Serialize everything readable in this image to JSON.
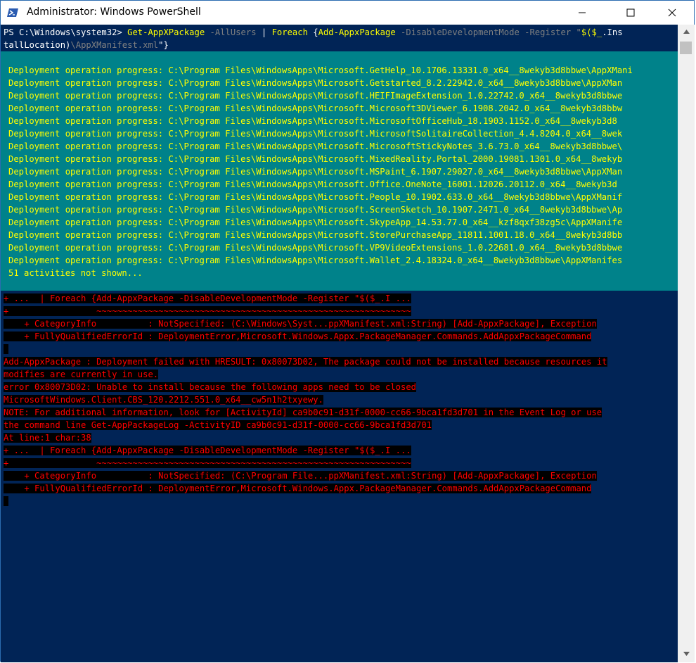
{
  "window": {
    "title": "Administrator: Windows PowerShell",
    "icon": "powershell-icon",
    "controls": [
      "minimize-icon",
      "maximize-icon",
      "close-icon"
    ]
  },
  "command": {
    "prompt": "PS C:\\Windows\\system32> ",
    "cmdlet": "Get-AppXPackage",
    "param1": " -AllUsers",
    "pipe": " | ",
    "foreach": "Foreach",
    "brace_open": " {",
    "inner_cmdlet": "Add-AppxPackage",
    "param2": " -DisableDevelopmentMode",
    "param3": " -Register",
    "str_start": " \"",
    "var_expr": "$($_",
    "prop_start": ".Ins",
    "line2_a": "tallLocation)",
    "line2_b": "\\AppXManifest.xml",
    "line2_c": "\"}"
  },
  "progress": {
    "lines": [
      "Deployment operation progress: C:\\Program Files\\WindowsApps\\Microsoft.GetHelp_10.1706.13331.0_x64__8wekyb3d8bbwe\\AppXMani",
      "Deployment operation progress: C:\\Program Files\\WindowsApps\\Microsoft.Getstarted_8.2.22942.0_x64__8wekyb3d8bbwe\\AppXMan",
      "Deployment operation progress: C:\\Program Files\\WindowsApps\\Microsoft.HEIFImageExtension_1.0.22742.0_x64__8wekyb3d8bbwe",
      "Deployment operation progress: C:\\Program Files\\WindowsApps\\Microsoft.Microsoft3DViewer_6.1908.2042.0_x64__8wekyb3d8bbw",
      "Deployment operation progress: C:\\Program Files\\WindowsApps\\Microsoft.MicrosoftOfficeHub_18.1903.1152.0_x64__8wekyb3d8",
      "Deployment operation progress: C:\\Program Files\\WindowsApps\\Microsoft.MicrosoftSolitaireCollection_4.4.8204.0_x64__8wek",
      "Deployment operation progress: C:\\Program Files\\WindowsApps\\Microsoft.MicrosoftStickyNotes_3.6.73.0_x64__8wekyb3d8bbwe\\",
      "Deployment operation progress: C:\\Program Files\\WindowsApps\\Microsoft.MixedReality.Portal_2000.19081.1301.0_x64__8wekyb",
      "Deployment operation progress: C:\\Program Files\\WindowsApps\\Microsoft.MSPaint_6.1907.29027.0_x64__8wekyb3d8bbwe\\AppXMan",
      "Deployment operation progress: C:\\Program Files\\WindowsApps\\Microsoft.Office.OneNote_16001.12026.20112.0_x64__8wekyb3d",
      "Deployment operation progress: C:\\Program Files\\WindowsApps\\Microsoft.People_10.1902.633.0_x64__8wekyb3d8bbwe\\AppXManif",
      "Deployment operation progress: C:\\Program Files\\WindowsApps\\Microsoft.ScreenSketch_10.1907.2471.0_x64__8wekyb3d8bbwe\\Ap",
      "Deployment operation progress: C:\\Program Files\\WindowsApps\\Microsoft.SkypeApp_14.53.77.0_x64__kzf8qxf38zg5c\\AppXManife",
      "Deployment operation progress: C:\\Program Files\\WindowsApps\\Microsoft.StorePurchaseApp_11811.1001.18.0_x64__8wekyb3d8bb",
      "Deployment operation progress: C:\\Program Files\\WindowsApps\\Microsoft.VP9VideoExtensions_1.0.22681.0_x64__8wekyb3d8bbwe",
      "Deployment operation progress: C:\\Program Files\\WindowsApps\\Microsoft.Wallet_2.4.18324.0_x64__8wekyb3d8bbwe\\AppXManifes"
    ],
    "footer": "51 activities not shown..."
  },
  "errors": {
    "block1": [
      "+ ...  | Foreach {Add-AppxPackage -DisableDevelopmentMode -Register \"$($_.I ...",
      "+                 ~~~~~~~~~~~~~~~~~~~~~~~~~~~~~~~~~~~~~~~~~~~~~~~~~~~~~~~~~~~~~",
      "    + CategoryInfo          : NotSpecified: (C:\\Windows\\Syst...ppXManifest.xml:String) [Add-AppxPackage], Exception",
      "    + FullyQualifiedErrorId : DeploymentError,Microsoft.Windows.Appx.PackageManager.Commands.AddAppxPackageCommand",
      " "
    ],
    "block2": [
      "Add-AppxPackage : Deployment failed with HRESULT: 0x80073D02, The package could not be installed because resources it",
      "modifies are currently in use.",
      "error 0x80073D02: Unable to install because the following apps need to be closed",
      "MicrosoftWindows.Client.CBS_120.2212.551.0_x64__cw5n1h2txyewy.",
      "NOTE: For additional information, look for [ActivityId] ca9b0c91-d31f-0000-cc66-9bca1fd3d701 in the Event Log or use",
      "the command line Get-AppPackageLog -ActivityID ca9b0c91-d31f-0000-cc66-9bca1fd3d701",
      "At line:1 char:38",
      "+ ...  | Foreach {Add-AppxPackage -DisableDevelopmentMode -Register \"$($_.I ...",
      "+                 ~~~~~~~~~~~~~~~~~~~~~~~~~~~~~~~~~~~~~~~~~~~~~~~~~~~~~~~~~~~~~",
      "    + CategoryInfo          : NotSpecified: (C:\\Program File...ppXManifest.xml:String) [Add-AppxPackage], Exception",
      "    + FullyQualifiedErrorId : DeploymentError,Microsoft.Windows.Appx.PackageManager.Commands.AddAppxPackageCommand",
      " "
    ]
  },
  "colors": {
    "console_bg": "#012456",
    "progress_bg": "#00828a",
    "progress_text": "#ffff00",
    "error_text": "#ff0000",
    "error_bg": "#000000"
  }
}
